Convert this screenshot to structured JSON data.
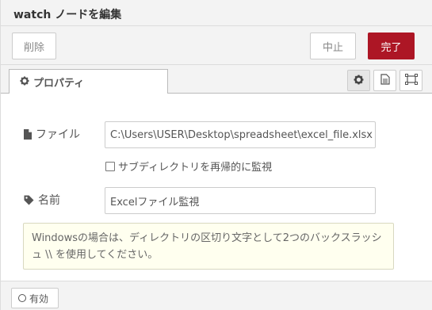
{
  "tray": {
    "title": "watch ノードを編集"
  },
  "toolbar": {
    "delete_label": "削除",
    "cancel_label": "中止",
    "done_label": "完了",
    "done_color": "#ad1625"
  },
  "tabs": {
    "properties_label": "プロパティ",
    "icons": [
      "gear-icon",
      "document-icon",
      "frame-icon"
    ]
  },
  "form": {
    "file_label": "ファイル",
    "file_value": "C:\\Users\\USER\\Desktop\\spreadsheet\\excel_file.xlsx",
    "subdir_label": "サブディレクトリを再帰的に監視",
    "subdir_checked": false,
    "name_label": "名前",
    "name_value": "Excelファイル監視"
  },
  "tip": {
    "text": "Windowsの場合は、ディレクトリの区切り文字として2つのバックスラッシュ \\\\ を使用してください。"
  },
  "footer": {
    "enable_label": "有効"
  }
}
